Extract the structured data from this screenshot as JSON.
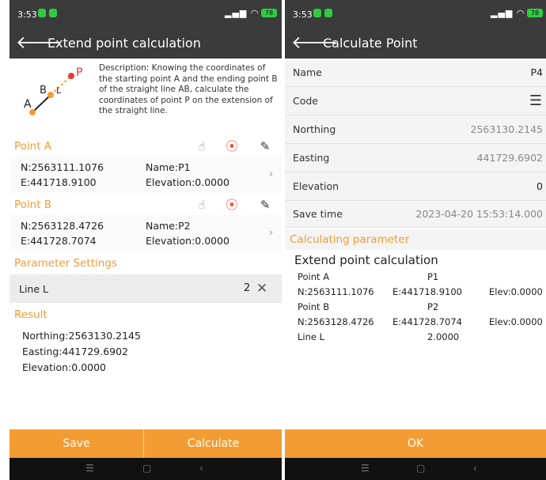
{
  "status": {
    "time": "3:53",
    "signal": "⁴⁶ᴵᴵ",
    "battery": "78"
  },
  "left": {
    "title": "Extend point calculation",
    "diagram": {
      "label_p": "P",
      "label_b": "B",
      "label_l": "L",
      "label_a": "A"
    },
    "description": "Description: Knowing the coordinates of the starting point A and the ending point B of the straight line AB, calculate the coordinates of point P on the extension of the straight line.",
    "point_a": {
      "header": "Point A",
      "n": "N:2563111.1076",
      "e": "E:441718.9100",
      "name": "Name:P1",
      "elev": "Elevation:0.0000"
    },
    "point_b": {
      "header": "Point B",
      "n": "N:2563128.4726",
      "e": "E:441728.7074",
      "name": "Name:P2",
      "elev": "Elevation:0.0000"
    },
    "params_header": "Parameter Settings",
    "line_l_label": "Line L",
    "line_l_value": "2",
    "result_header": "Result",
    "result": {
      "northing": "Northing:2563130.2145",
      "easting": "Easting:441729.6902",
      "elevation": "Elevation:0.0000"
    },
    "save_label": "Save",
    "calculate_label": "Calculate"
  },
  "right": {
    "title": "Calculate Point",
    "rows": [
      {
        "label": "Name",
        "value": "P4"
      },
      {
        "label": "Code",
        "value": ""
      },
      {
        "label": "Northing",
        "value": "2563130.2145"
      },
      {
        "label": "Easting",
        "value": "441729.6902"
      },
      {
        "label": "Elevation",
        "value": "0"
      },
      {
        "label": "Save time",
        "value": "2023-04-20 15:53:14.000"
      }
    ],
    "calc_header": "Calculating parameter",
    "calc_title": "Extend point calculation",
    "calc": {
      "pa_label": "Point A",
      "pa_name": "P1",
      "pa_n": "N:2563111.1076",
      "pa_e": "E:441718.9100",
      "pa_elev": "Elev:0.0000",
      "pb_label": "Point B",
      "pb_name": "P2",
      "pb_n": "N:2563128.4726",
      "pb_e": "E:441728.7074",
      "pb_elev": "Elev:0.0000",
      "line_label": "Line L",
      "line_value": "2.0000"
    },
    "ok_label": "OK"
  },
  "colors": {
    "accent": "#f39c33",
    "appbar": "#3b3b3b",
    "point_a": "#f39c33",
    "point_p": "#e53935"
  }
}
